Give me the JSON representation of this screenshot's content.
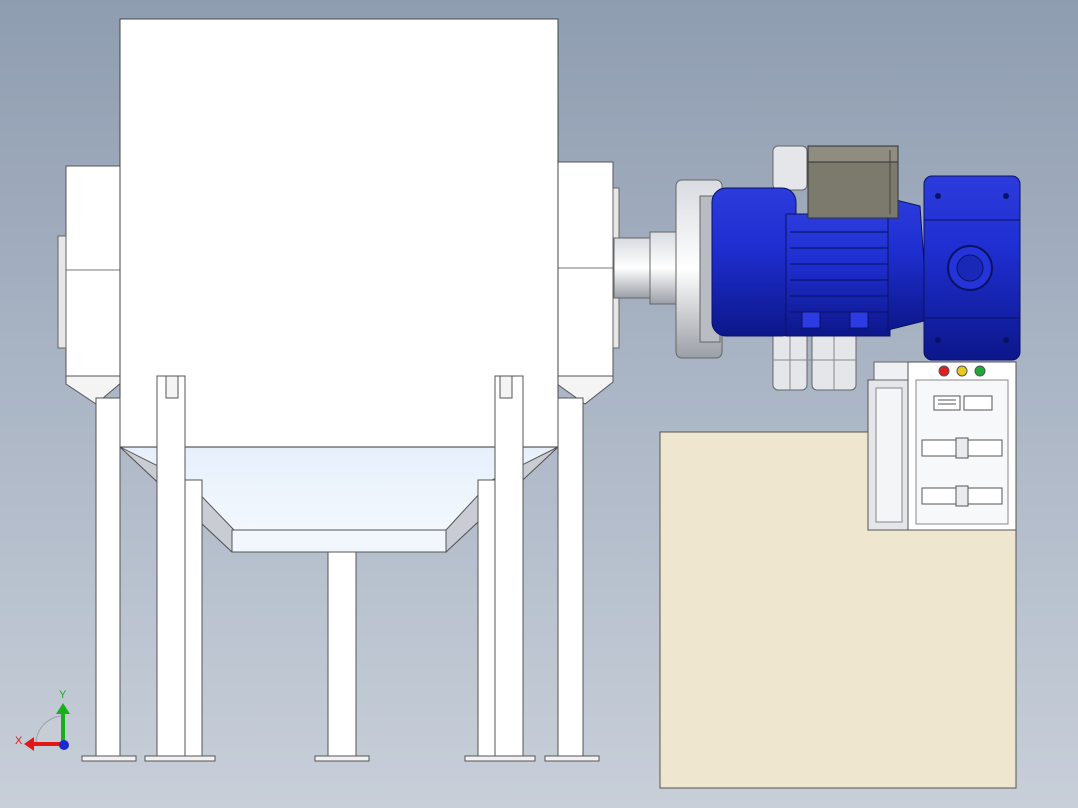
{
  "viewport": {
    "background_top": "#8f9db1",
    "background_bottom": "#c8cfd9"
  },
  "triad": {
    "x_label": "X",
    "y_label": "Y",
    "x_color": "#e01818",
    "y_color": "#18b018",
    "z_color": "#1a2acc"
  },
  "model": {
    "motor_color": "#1f2ed0",
    "hopper_color": "#ffffff",
    "base_plate_color": "#efe6cf",
    "terminal_box_color": "#7b7a6c",
    "indicator_lights": [
      "red-light",
      "yellow-light",
      "green-light"
    ],
    "indicator_colors": [
      "#e02020",
      "#e6c81e",
      "#1fa83a"
    ]
  }
}
